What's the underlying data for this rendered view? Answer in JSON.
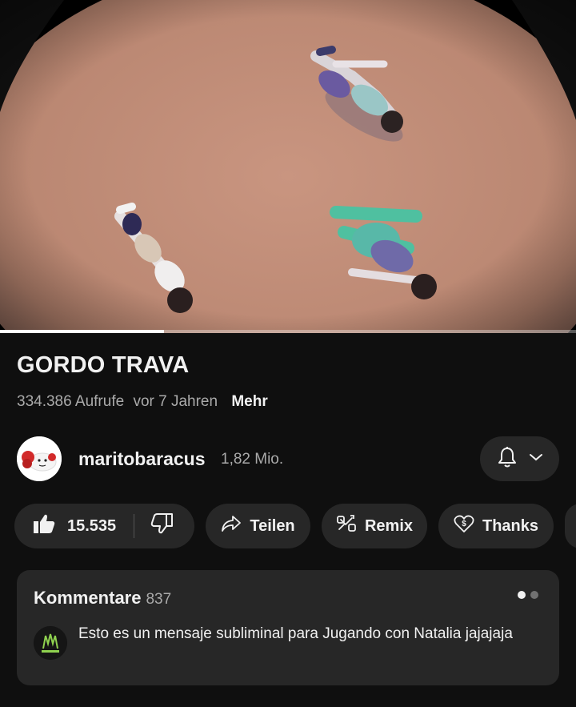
{
  "video": {
    "progress_fraction": 0.285
  },
  "title": "GORDO TRAVA",
  "meta": {
    "views": "334.386 Aufrufe",
    "age": "vor 7 Jahren",
    "more": "Mehr"
  },
  "channel": {
    "name": "maritobaracus",
    "subscribers": "1,82 Mio.",
    "bell_icon": "bell-icon",
    "chevron_icon": "chevron-down-icon"
  },
  "actions": {
    "like_count": "15.535",
    "like_icon": "thumbs-up-icon",
    "dislike_icon": "thumbs-down-icon",
    "share_label": "Teilen",
    "share_icon": "share-arrow-icon",
    "remix_label": "Remix",
    "remix_icon": "remix-icon",
    "thanks_label": "Thanks",
    "thanks_icon": "heart-dollar-icon"
  },
  "comments": {
    "title": "Kommentare",
    "count": "837",
    "top_comment": {
      "text": "Esto es un mensaje subliminal para Jugando con Natalia jajajaja"
    }
  },
  "colors": {
    "background": "#0f0f0f",
    "pill": "#272727",
    "text_primary": "#f1f1f1",
    "text_secondary": "#aaaaaa"
  }
}
